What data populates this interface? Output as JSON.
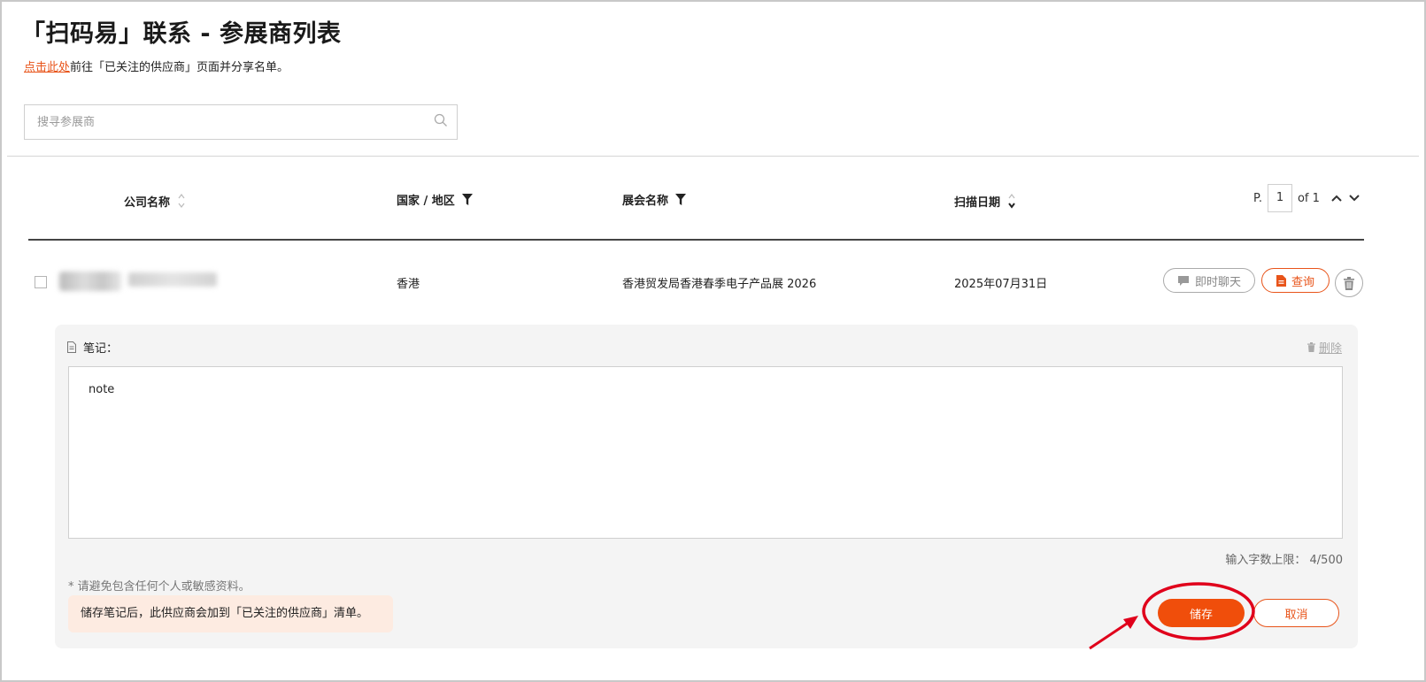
{
  "page": {
    "title": "「扫码易」联系 - 参展商列表",
    "link_text": "点击此处",
    "link_suffix": "前往「已关注的供应商」页面并分享名单。"
  },
  "search": {
    "placeholder": "搜寻参展商",
    "icon": "search-icon"
  },
  "table": {
    "headers": {
      "company": "公司名称",
      "region": "国家 / 地区",
      "fair": "展会名称",
      "scan_date": "扫描日期"
    },
    "pager": {
      "prefix": "P.",
      "current": "1",
      "of": "of 1"
    },
    "rows": [
      {
        "region": "香港",
        "fair": "香港贸发局香港春季电子产品展 2026",
        "scan_date": "2025年07月31日",
        "chat_label": "即时聊天",
        "query_label": "查询"
      }
    ]
  },
  "note": {
    "label": "笔记：",
    "delete_label": "删除",
    "text": "note",
    "limit": "输入字数上限： 4/500",
    "warning": "* 请避免包含任何个人或敏感资料。",
    "info": "储存笔记后，此供应商会加到「已关注的供应商」清单。",
    "save_label": "储存",
    "cancel_label": "取消"
  },
  "colors": {
    "accent": "#f04e0b",
    "annotation": "#e0001b"
  }
}
